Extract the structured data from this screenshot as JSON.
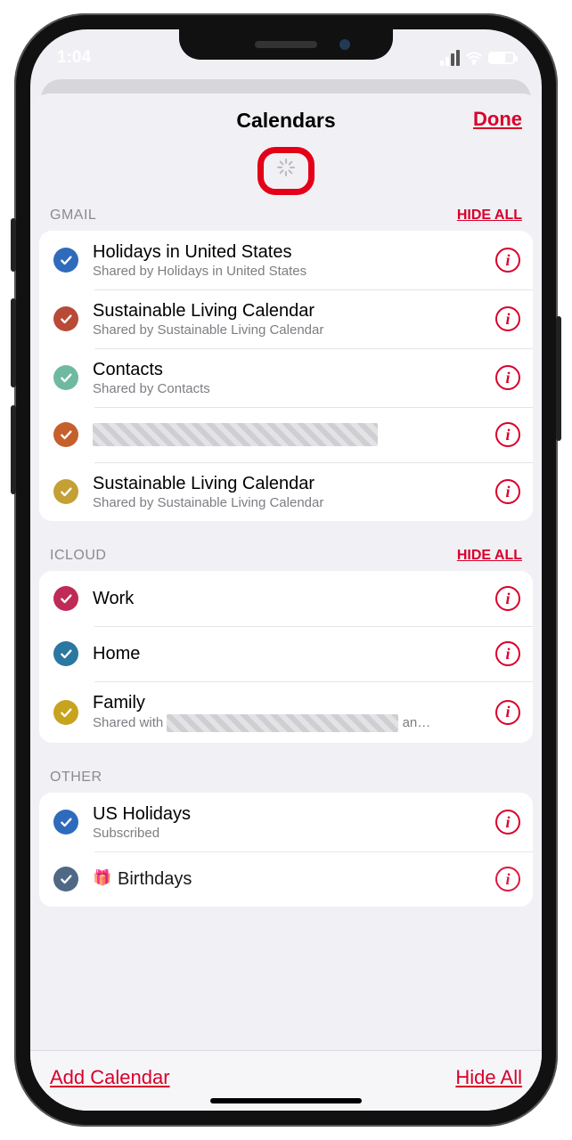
{
  "status": {
    "time": "1:04"
  },
  "header": {
    "title": "Calendars",
    "done": "Done"
  },
  "sections": {
    "gmail": {
      "label": "GMAIL",
      "action": "HIDE ALL",
      "items": [
        {
          "title": "Holidays in United States",
          "sub": "Shared by Holidays in United States",
          "color": "c-blue"
        },
        {
          "title": "Sustainable Living Calendar",
          "sub": "Shared by Sustainable Living Calendar",
          "color": "c-red"
        },
        {
          "title": "Contacts",
          "sub": "Shared by Contacts",
          "color": "c-teal"
        },
        {
          "title": "",
          "sub": "",
          "color": "c-orange",
          "redacted": true
        },
        {
          "title": "Sustainable Living Calendar",
          "sub": "Shared by Sustainable Living Calendar",
          "color": "c-gold"
        }
      ]
    },
    "icloud": {
      "label": "ICLOUD",
      "action": "HIDE ALL",
      "items": [
        {
          "title": "Work",
          "color": "c-magenta"
        },
        {
          "title": "Home",
          "color": "c-steel"
        },
        {
          "title": "Family",
          "sub_prefix": "Shared with",
          "sub_suffix": "an…",
          "color": "c-mustard",
          "sub_redacted": true
        }
      ]
    },
    "other": {
      "label": "OTHER",
      "items": [
        {
          "title": "US Holidays",
          "sub": "Subscribed",
          "color": "c-blue"
        },
        {
          "title": "Birthdays",
          "color": "c-navy",
          "gift": true
        }
      ]
    }
  },
  "toolbar": {
    "add": "Add Calendar",
    "hideall": "Hide All"
  }
}
